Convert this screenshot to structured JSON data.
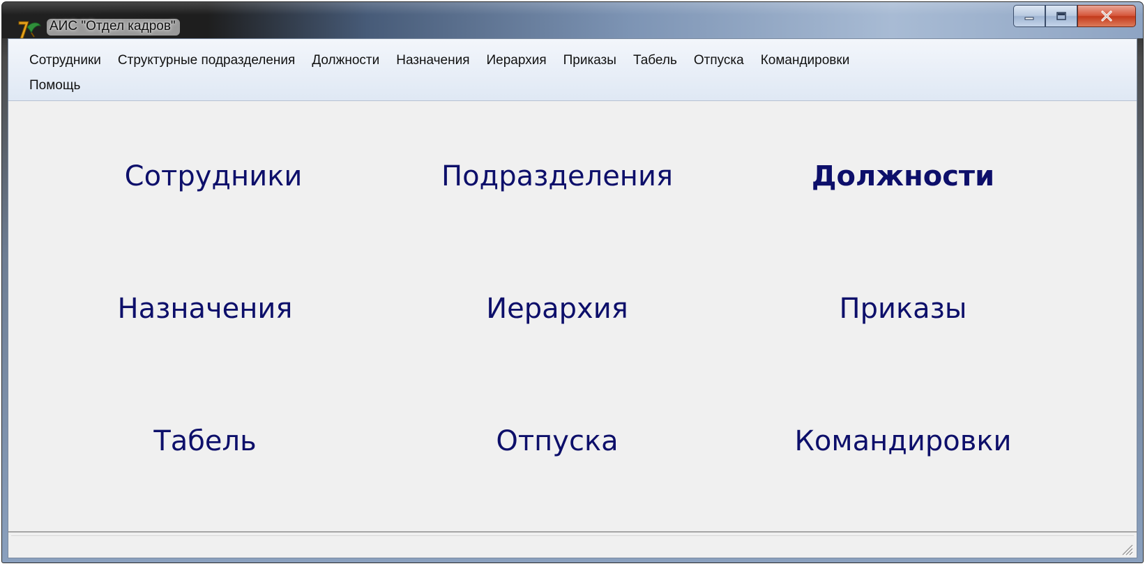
{
  "window": {
    "title": "АИС \"Отдел кадров\"",
    "icon": "delphi-app-icon",
    "controls": [
      "minimize-icon",
      "maximize-icon",
      "close-icon"
    ]
  },
  "menu": {
    "row1": [
      "Сотрудники",
      "Структурные подразделения",
      "Должности",
      "Назначения",
      "Иерархия",
      "Приказы",
      "Табель",
      "Отпуска",
      "Командировки"
    ],
    "row2": [
      "Помощь"
    ]
  },
  "dashboard": {
    "employees": "Сотрудники",
    "departments": "Подразделения",
    "positions": "Должности",
    "appointments": "Назначения",
    "hierarchy": "Иерархия",
    "orders": "Приказы",
    "timesheet": "Табель",
    "vacations": "Отпуска",
    "business_trips": "Командировки"
  },
  "colors": {
    "dashboard_text": "#0d0f6a",
    "client_bg": "#f0f0f0"
  }
}
